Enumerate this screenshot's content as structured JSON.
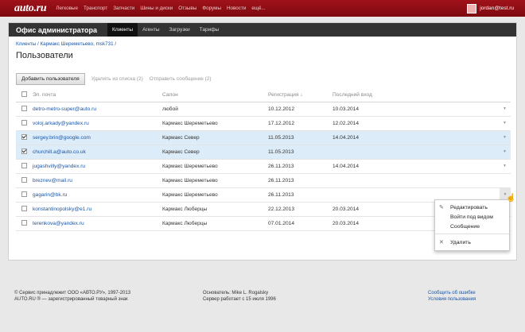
{
  "topbar": {
    "logo": "auto.ru",
    "nav": [
      "Легковые",
      "Транспорт",
      "Запчасти",
      "Шины и диски",
      "Отзывы",
      "Форумы",
      "Новости",
      "ещё..."
    ],
    "user_email": "jordan@test.ru"
  },
  "app": {
    "title": "Офис администратора",
    "tabs": [
      "Клиенты",
      "Агенты",
      "Загрузки",
      "Тарифы"
    ],
    "active_tab": "Клиенты"
  },
  "breadcrumb": "Клиенты / Кармакс Шереметьево, msk731 /",
  "page_title": "Пользователи",
  "toolbar": {
    "add_user": "Добавить пользователя",
    "remove_from_list": "Удалить из списка (2)",
    "send_message": "Отправить сообщение (2)"
  },
  "table": {
    "headers": {
      "email": "Эл. почта",
      "salon": "Салон",
      "registration": "Регистрация ↓",
      "last_login": "Последний вход"
    },
    "rows": [
      {
        "email": "detro-metro-super@auto.ru",
        "salon": "любой",
        "registration": "10.12.2012",
        "last_login": "10.03.2014",
        "checked": false
      },
      {
        "email": "voloj.arkady@yandex.ru",
        "salon": "Кармакс Шереметьево",
        "registration": "17.12.2012",
        "last_login": "12.02.2014",
        "checked": false
      },
      {
        "email": "sergey.brin@google.com",
        "salon": "Кармакс Север",
        "registration": "11.05.2013",
        "last_login": "14.04.2014",
        "checked": true
      },
      {
        "email": "churchill.a@auto.co.uk",
        "salon": "Кармакс Север",
        "registration": "11.05.2013",
        "last_login": "",
        "checked": true
      },
      {
        "email": "jugashvilly@yandex.ru",
        "salon": "Кармакс Шереметьево",
        "registration": "26.11.2013",
        "last_login": "14.04.2014",
        "checked": false
      },
      {
        "email": "breznev@mail.ru",
        "salon": "Кармакс Шереметьево",
        "registration": "26.11.2013",
        "last_login": "",
        "checked": false
      },
      {
        "email": "gagarin@bk.ru",
        "salon": "Кармакс Шереметьево",
        "registration": "26.11.2013",
        "last_login": "",
        "checked": false
      },
      {
        "email": "konstantinopolsky@e1.ru",
        "salon": "Кармакс Люберцы",
        "registration": "22.12.2013",
        "last_login": "20.03.2014",
        "checked": false
      },
      {
        "email": "terenkova@yandex.ru",
        "salon": "Кармакс Люберцы",
        "registration": "07.01.2014",
        "last_login": "20.03.2014",
        "checked": false
      }
    ],
    "row_menu_icon": "▼"
  },
  "dropdown": {
    "edit": "Редактировать",
    "login_as": "Войти под видом",
    "message": "Сообщение",
    "delete": "Удалить",
    "edit_icon": "✎",
    "delete_icon": "✕"
  },
  "footer": {
    "copyright_1": "© Сервис принадлежит ООО «АВТО.РУ», 1997-2013",
    "copyright_2": "AUTO.RU ® — зарегистрированный товарный знак",
    "founder": "Основатель: Mike L. Rogalsky",
    "server": "Сервер работает с 15 июля 1996",
    "report_error": "Сообщить об ошибке",
    "terms": "Условия пользования"
  },
  "colors": {
    "topbar": "#8e0e15",
    "link": "#1a56a8",
    "selected_row": "#dcecf8"
  }
}
